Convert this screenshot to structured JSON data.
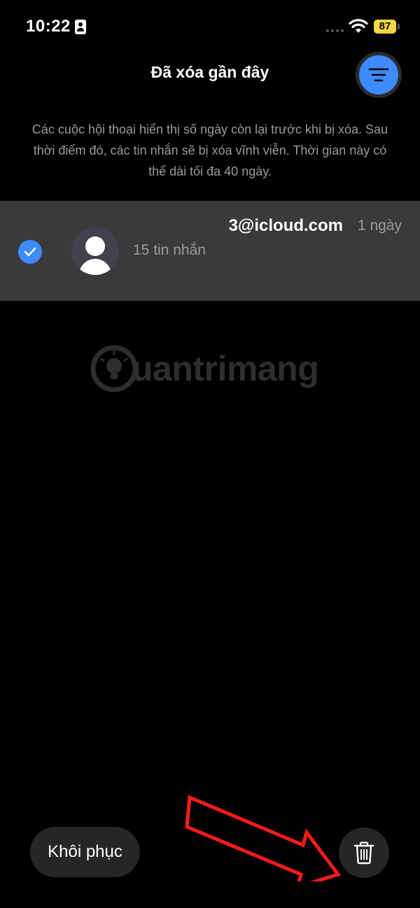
{
  "status_bar": {
    "time": "10:22",
    "battery": "87",
    "battery_color": "#f7d742"
  },
  "header": {
    "title": "Đã xóa gần đây",
    "filter_icon": "filter-lines-icon",
    "accent_color": "#3d8bfd"
  },
  "description": "Các cuộc hội thoại hiển thị số ngày còn lại trước khi bị xóa. Sau thời điểm đó, các tin nhắn sẽ bị xóa vĩnh viễn. Thời gian này có thể dài tối đa 40 ngày.",
  "conversations": [
    {
      "name": "3@icloud.com",
      "date": "1 ngày",
      "messages": "15 tin nhắn",
      "selected": true
    }
  ],
  "watermark": {
    "text": "uantrimang"
  },
  "actions": {
    "restore_label": "Khôi phục",
    "delete_icon": "trash-icon"
  }
}
